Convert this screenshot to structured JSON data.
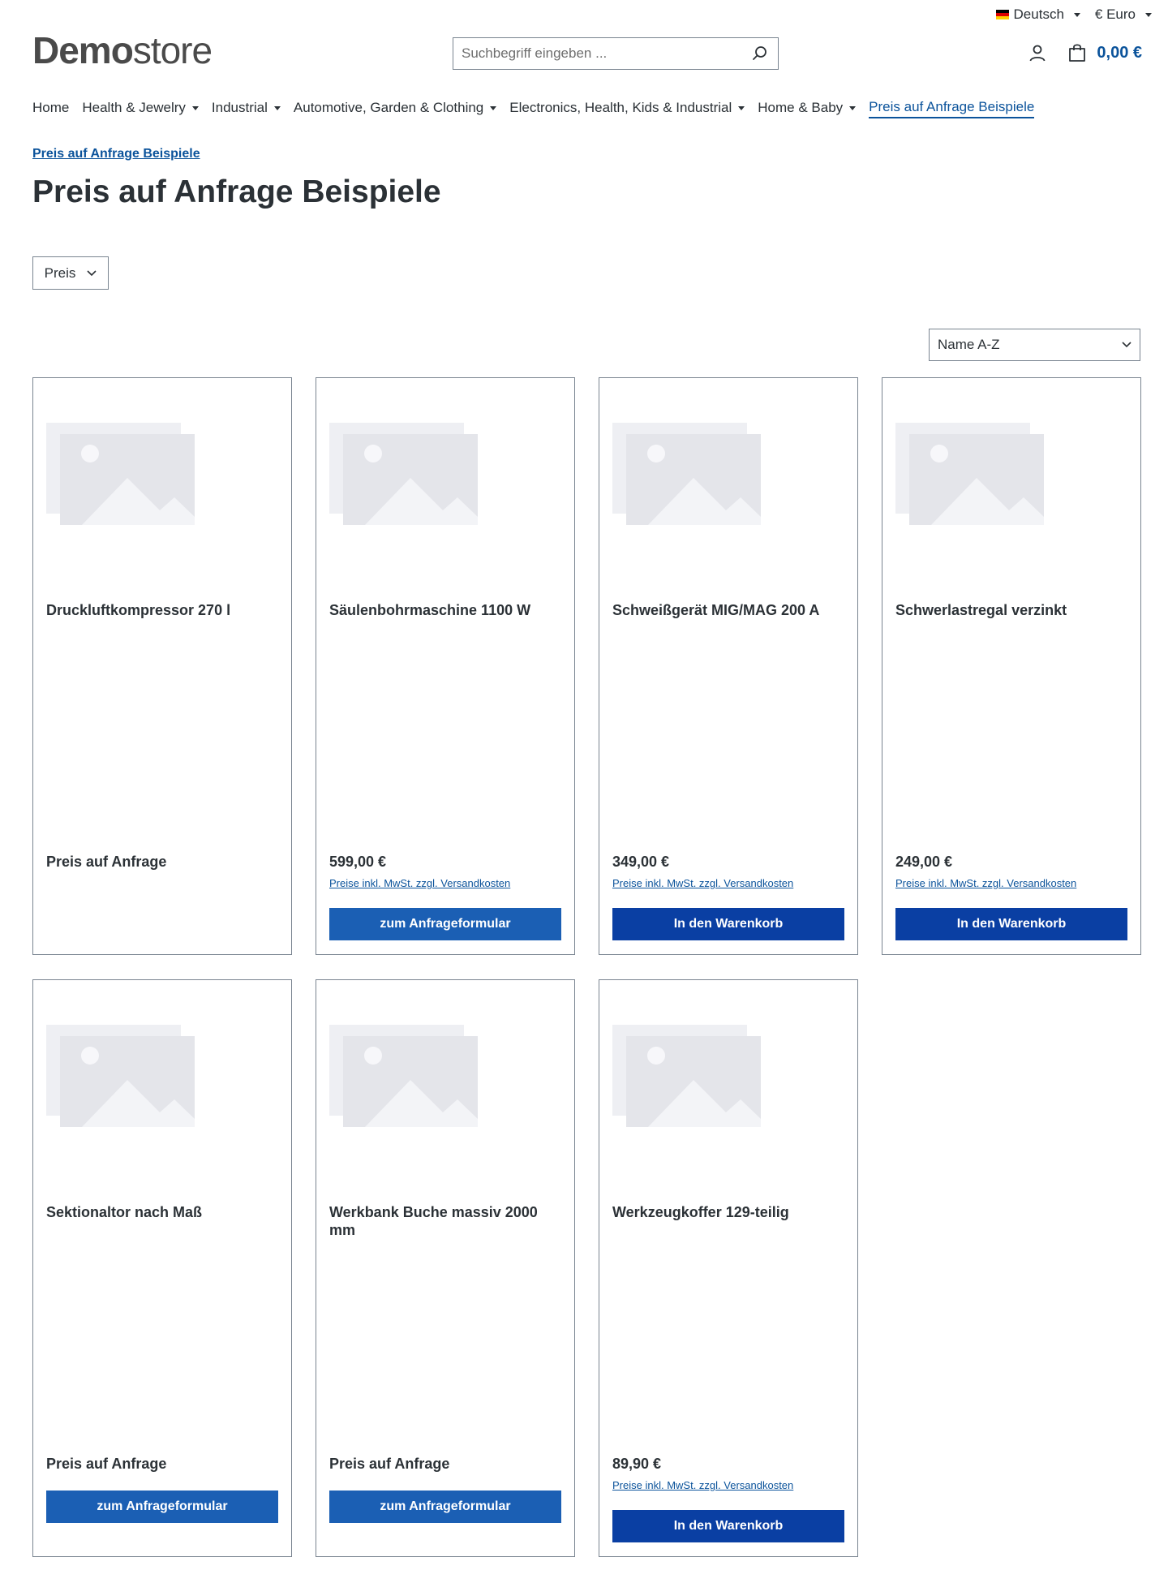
{
  "topbar": {
    "language": "Deutsch",
    "currency": "€ Euro"
  },
  "header": {
    "logo_bold": "Demo",
    "logo_light": "store",
    "search_placeholder": "Suchbegriff eingeben ...",
    "cart_total": "0,00 €"
  },
  "nav": {
    "items": [
      {
        "label": "Home"
      },
      {
        "label": "Health & Jewelry"
      },
      {
        "label": "Industrial"
      },
      {
        "label": "Automotive, Garden & Clothing"
      },
      {
        "label": "Electronics, Health, Kids & Industrial"
      },
      {
        "label": "Home & Baby"
      },
      {
        "label": "Preis auf Anfrage Beispiele"
      }
    ]
  },
  "breadcrumb": "Preis auf Anfrage Beispiele",
  "page_title": "Preis auf Anfrage Beispiele",
  "filter": {
    "label": "Preis"
  },
  "sort": {
    "selected": "Name A-Z"
  },
  "products": [
    {
      "name": "Druckluftkompressor 270 l",
      "price": "Preis auf Anfrage"
    },
    {
      "name": "Säulenbohrmaschine 1100 W",
      "price": "599,00 €",
      "tax_note": "Preise inkl. MwSt. zzgl. Versandkosten",
      "button": "zum Anfrageformular"
    },
    {
      "name": "Schweißgerät MIG/MAG 200 A",
      "price": "349,00 €",
      "tax_note": "Preise inkl. MwSt. zzgl. Versandkosten",
      "button": "In den Warenkorb"
    },
    {
      "name": "Schwerlastregal verzinkt",
      "price": "249,00 €",
      "tax_note": "Preise inkl. MwSt. zzgl. Versandkosten",
      "button": "In den Warenkorb"
    },
    {
      "name": "Sektionaltor nach Maß",
      "price": "Preis auf Anfrage",
      "button": "zum Anfrageformular"
    },
    {
      "name": "Werkbank Buche massiv 2000 mm",
      "price": "Preis auf Anfrage",
      "button": "zum Anfrageformular"
    },
    {
      "name": "Werkzeugkoffer 129-teilig",
      "price": "89,90 €",
      "tax_note": "Preise inkl. MwSt. zzgl. Versandkosten",
      "button": "In den Warenkorb"
    }
  ],
  "colors": {
    "link": "#0b539b",
    "inquiry_button": "#1b5fb4",
    "cart_button": "#0a3fa3"
  }
}
